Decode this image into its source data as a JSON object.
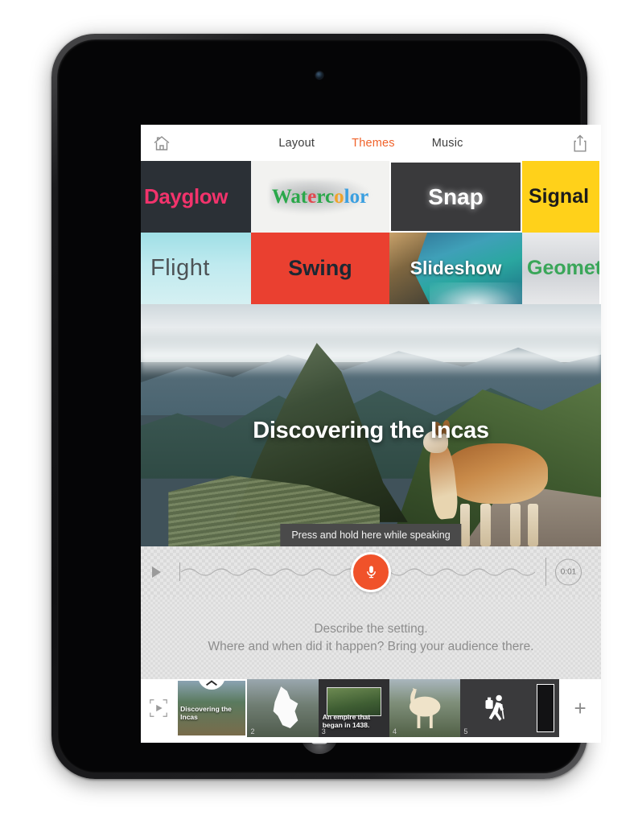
{
  "app": {
    "topbar": {
      "home_icon": "home-icon",
      "share_icon": "share-icon",
      "tabs": [
        {
          "label": "Layout",
          "active": false
        },
        {
          "label": "Themes",
          "active": true
        },
        {
          "label": "Music",
          "active": false
        }
      ],
      "active_color": "#f0622a"
    },
    "themes": {
      "row1": [
        {
          "name": "Dayglow",
          "text_color": "#f2336c",
          "bg_color": "#2b3036",
          "selected": false
        },
        {
          "name": "Watercolor",
          "text_color": "#2aa84a",
          "bg_color": "#f2f2f0",
          "selected": false
        },
        {
          "name": "Snap",
          "text_color": "#ffffff",
          "bg_color": "#3a3a3c",
          "selected": true
        },
        {
          "name": "Signal",
          "text_color": "#1c1c1c",
          "bg_color": "#ffd11a",
          "selected": false
        }
      ],
      "row2": [
        {
          "name": "Flight",
          "text_color": "#4d5356",
          "bg_color": "#bfeaef",
          "selected": false
        },
        {
          "name": "Swing",
          "text_color": "#1c2833",
          "bg_color": "#ea4030",
          "selected": false
        },
        {
          "name": "Slideshow",
          "text_color": "#ffffff",
          "bg_color": "#2f6d92",
          "selected": false
        },
        {
          "name": "Geometry",
          "text_color": "#3aa659",
          "bg_color": "#dfe1e4",
          "selected": false
        }
      ]
    },
    "preview": {
      "title": "Discovering the Incas",
      "tooltip": "Press and hold here while speaking"
    },
    "recorder": {
      "play_icon": "play-icon",
      "mic_icon": "microphone-icon",
      "duration": "0:01",
      "accent_color": "#f0522a"
    },
    "prompt": {
      "line1": "Describe the setting.",
      "line2": "Where and when did it happen? Bring your audience there."
    },
    "filmstrip": {
      "preview_icon": "preview-play-icon",
      "add_label": "+",
      "slides": [
        {
          "num": "",
          "caption": "Discovering the Incas",
          "active": true
        },
        {
          "num": "2",
          "caption": "",
          "active": false
        },
        {
          "num": "3",
          "caption": "An empire that began in 1438.",
          "active": false
        },
        {
          "num": "4",
          "caption": "",
          "active": false
        },
        {
          "num": "5",
          "caption": "",
          "active": false
        }
      ]
    }
  }
}
